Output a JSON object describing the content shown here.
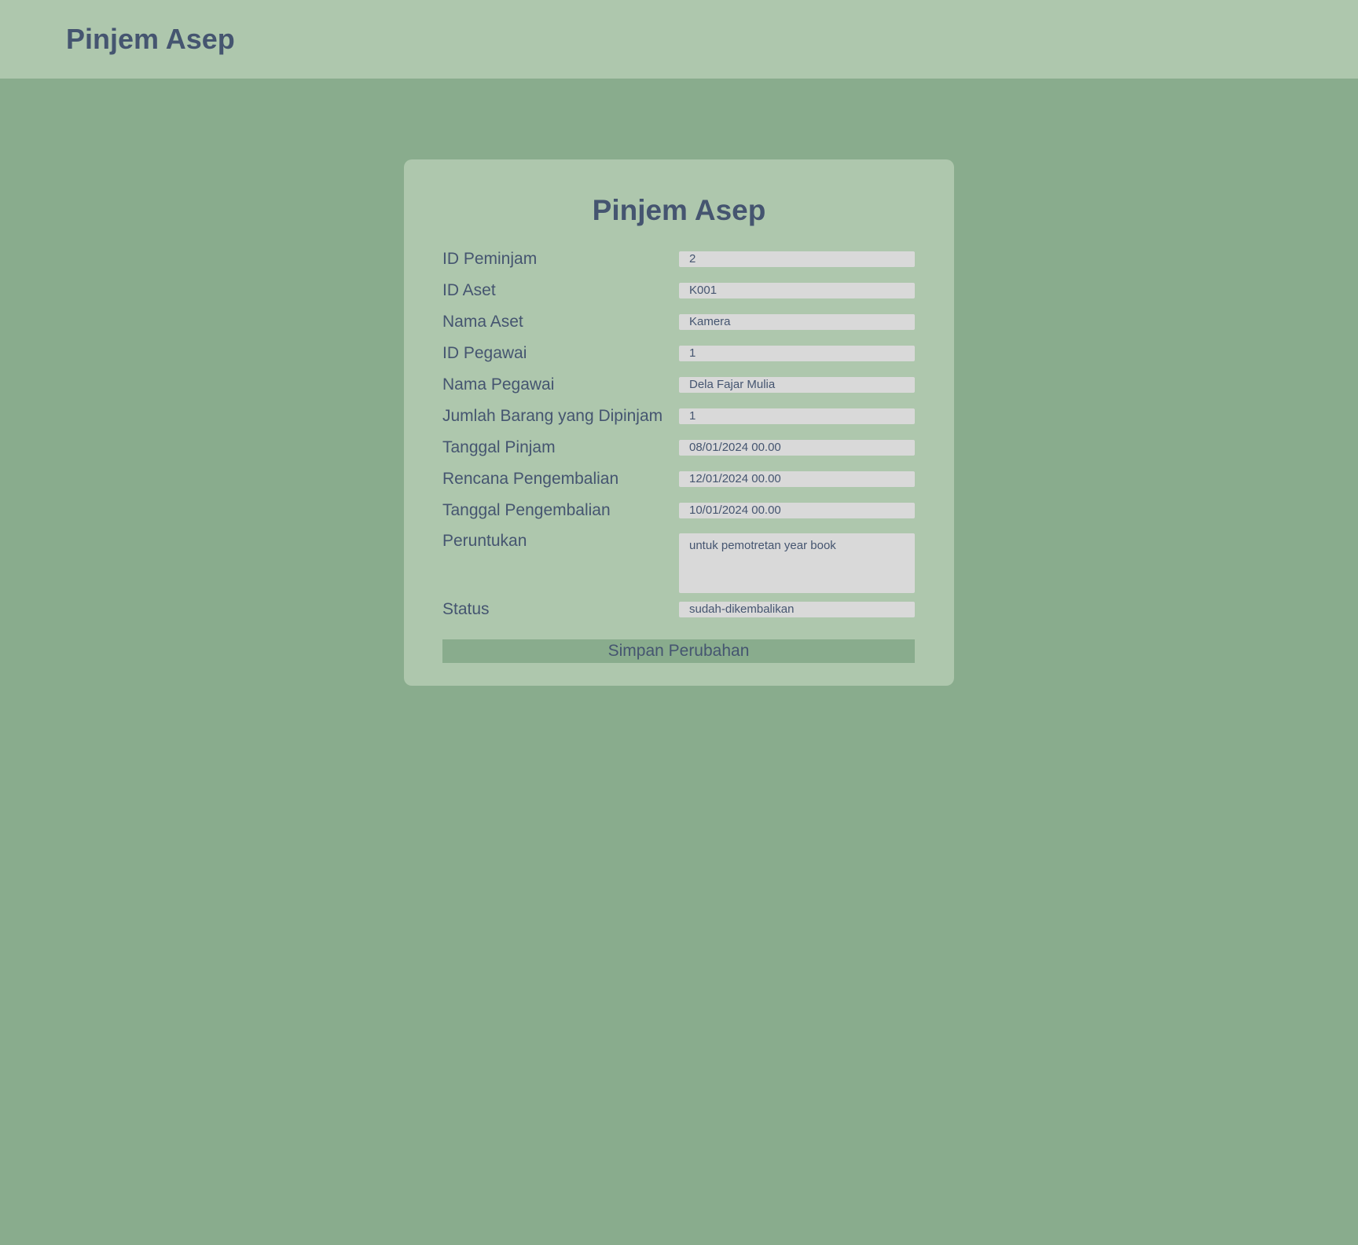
{
  "header": {
    "brand": "Pinjem Asep"
  },
  "form": {
    "title": "Pinjem Asep",
    "fields": [
      {
        "label": "ID Peminjam",
        "value": "2"
      },
      {
        "label": "ID Aset",
        "value": "K001"
      },
      {
        "label": "Nama Aset",
        "value": "Kamera"
      },
      {
        "label": "ID Pegawai",
        "value": "1"
      },
      {
        "label": "Nama Pegawai",
        "value": "Dela Fajar Mulia"
      },
      {
        "label": "Jumlah Barang yang Dipinjam",
        "value": "1"
      },
      {
        "label": "Tanggal Pinjam",
        "value": "08/01/2024 00.00"
      },
      {
        "label": "Rencana Pengembalian",
        "value": "12/01/2024 00.00"
      },
      {
        "label": "Tanggal Pengembalian",
        "value": "10/01/2024 00.00"
      },
      {
        "label": "Peruntukan",
        "value": "untuk pemotretan year book"
      },
      {
        "label": "Status",
        "value": "sudah-dikembalikan"
      }
    ],
    "submit_label": "Simpan Perubahan"
  },
  "colors": {
    "page_background": "#89ac8d",
    "header_background": "#aec7ad",
    "card_background": "#aec7ad",
    "text": "#455570",
    "input_background": "#d9d9d9",
    "button_background": "#89ac8d"
  }
}
